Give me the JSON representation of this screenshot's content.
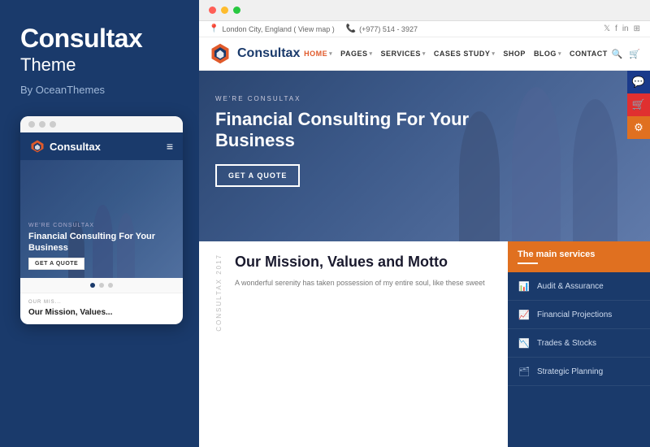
{
  "leftPanel": {
    "title": "Consultax",
    "subtitle": "Theme",
    "author": "By OceanThemes"
  },
  "mobileMockup": {
    "dots": [
      "dot1",
      "dot2",
      "dot3"
    ],
    "logoText": "Consultax",
    "heroLabel": "WE'RE CONSULTAX",
    "heroTitle": "Financial Consulting For Your Business",
    "heroCta": "GET A QUOTE",
    "bottomDots": [
      true,
      false,
      false
    ],
    "missionTitle": "Our Mis..."
  },
  "browser": {
    "topbar": {
      "location": "London City, England ( View map )",
      "phone": "(+977) 514 - 3927",
      "socialIcons": [
        "twitter",
        "facebook",
        "linkedin",
        "rss"
      ]
    },
    "navbar": {
      "logoText": "Consultax",
      "links": [
        {
          "label": "HOME",
          "active": true,
          "hasArrow": true
        },
        {
          "label": "PAGES",
          "active": false,
          "hasArrow": true
        },
        {
          "label": "SERVICES",
          "active": false,
          "hasArrow": true
        },
        {
          "label": "CASES STUDY",
          "active": false,
          "hasArrow": true
        },
        {
          "label": "SHOP",
          "active": false,
          "hasArrow": false
        },
        {
          "label": "BLOG",
          "active": false,
          "hasArrow": true
        },
        {
          "label": "CONTACT",
          "active": false,
          "hasArrow": false
        }
      ]
    },
    "hero": {
      "label": "WE'RE CONSULTAX",
      "title": "Financial Consulting For Your Business",
      "cta": "GET A QUOTE"
    },
    "mission": {
      "yearLabel": "CONSULTAX 2017",
      "title": "Our Mission, Values and Motto",
      "text": "A wonderful serenity has taken possession of my entire soul, like these sweet"
    },
    "services": {
      "title": "The main services",
      "items": [
        {
          "icon": "📊",
          "name": "Audit & Assurance"
        },
        {
          "icon": "📈",
          "name": "Financial Projections"
        },
        {
          "icon": "📉",
          "name": "Trades & Stocks"
        },
        {
          "icon": "🗂",
          "name": "Strategic Planning"
        }
      ]
    }
  },
  "colors": {
    "darkBlue": "#1a3a6b",
    "orange": "#e07020",
    "red": "#e03030",
    "white": "#ffffff"
  }
}
